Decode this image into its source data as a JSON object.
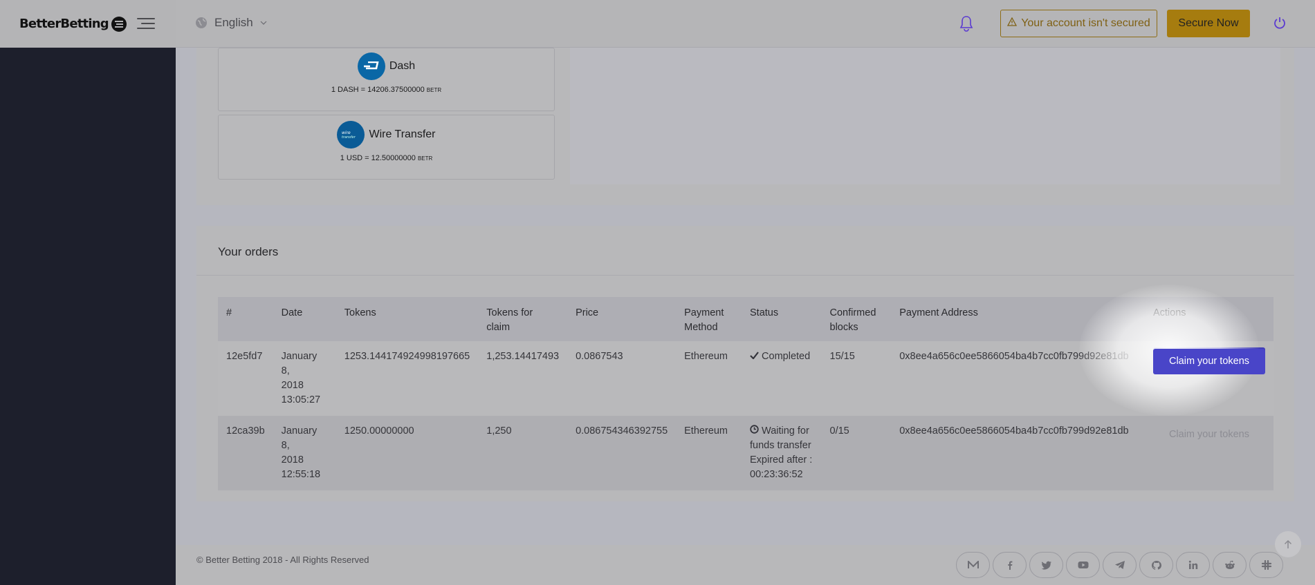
{
  "brand": {
    "name": "BetterBetting"
  },
  "header": {
    "language": "English",
    "alert_text": "Your account isn't secured",
    "secure_button": "Secure Now"
  },
  "payment_methods": [
    {
      "name": "Dash",
      "rate": "1 DASH = 14206.37500000",
      "unit": "BETR",
      "icon": "dash-icon"
    },
    {
      "name": "Wire Transfer",
      "rate": "1 USD = 12.50000000",
      "unit": "BETR",
      "icon": "wire-transfer-icon"
    }
  ],
  "orders": {
    "title": "Your orders",
    "headers": {
      "id": "#",
      "date": "Date",
      "tokens": "Tokens",
      "tokens_claim_1": "Tokens for",
      "tokens_claim_2": "claim",
      "price": "Price",
      "method_1": "Payment",
      "method_2": "Method",
      "status": "Status",
      "blocks_1": "Confirmed",
      "blocks_2": "blocks",
      "address": "Payment Address",
      "actions": "Actions"
    },
    "rows": [
      {
        "id": "12e5fd7",
        "date_1": "January 8,",
        "date_2": "2018",
        "date_3": "13:05:27",
        "tokens": "1253.144174924998197665",
        "tokens_claim": "1,253.14417493",
        "price": "0.0867543",
        "method": "Ethereum",
        "status": "Completed",
        "blocks": "15/15",
        "address": "0x8ee4a656c0ee5866054ba4b7cc0fb799d92e81db",
        "action": "Claim your tokens"
      },
      {
        "id": "12ca39b",
        "date_1": "January 8,",
        "date_2": "2018",
        "date_3": "12:55:18",
        "tokens": "1250.00000000",
        "tokens_claim": "1,250",
        "price": "0.086754346392755",
        "method": "Ethereum",
        "status_1": "Waiting for",
        "status_2": "funds transfer",
        "status_3": "Expired after :",
        "status_4": "00:23:36:52",
        "blocks": "0/15",
        "address": "0x8ee4a656c0ee5866054ba4b7cc0fb799d92e81db",
        "action": "Claim your tokens"
      }
    ]
  },
  "footer": {
    "copyright": "© Better Betting 2018 - All Rights Reserved",
    "socials": [
      "medium-icon",
      "facebook-icon",
      "twitter-icon",
      "youtube-icon",
      "telegram-icon",
      "github-icon",
      "linkedin-icon",
      "reddit-icon",
      "slack-icon"
    ]
  },
  "colors": {
    "accent": "#413db5",
    "warning": "#a67c0f",
    "sidebar": "#1d1f2c"
  }
}
